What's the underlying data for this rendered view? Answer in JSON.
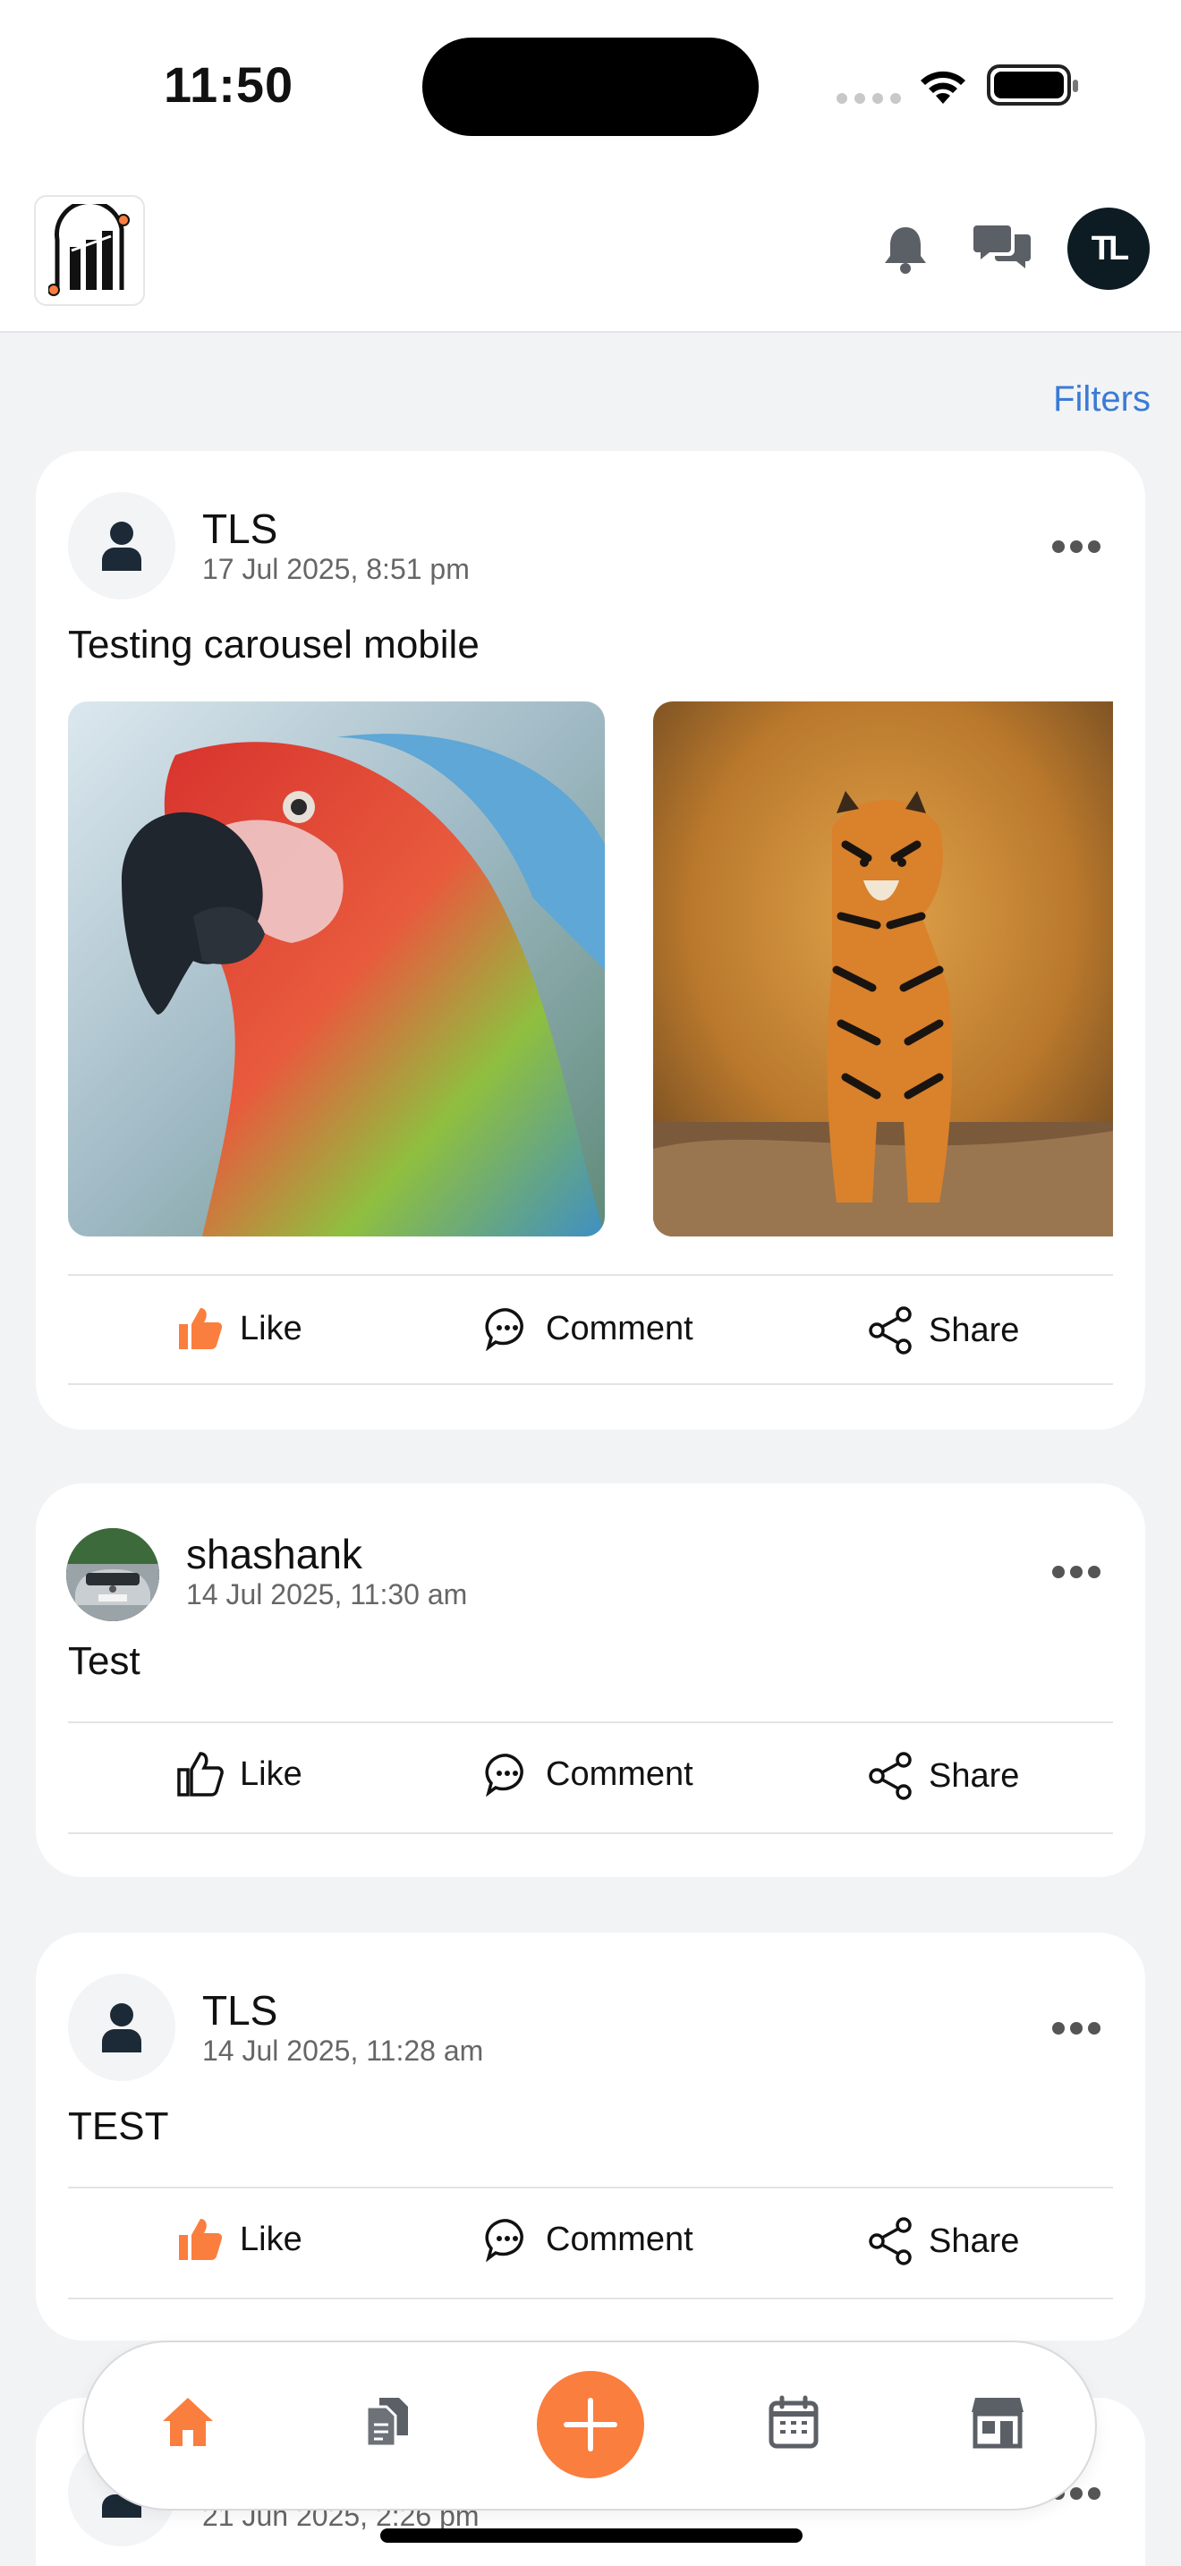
{
  "status_bar": {
    "time": "11:50"
  },
  "header": {
    "logo_icon": "building-logo-icon",
    "notification_icon": "bell-icon",
    "messages_icon": "chat-bubbles-icon",
    "user_initials": "TL"
  },
  "filters_label": "Filters",
  "posts": [
    {
      "author": "TLS",
      "date": "17 Jul 2025, 8:51 pm",
      "text": "Testing carousel mobile",
      "images": [
        "parrot-photo",
        "tiger-photo"
      ],
      "liked": true,
      "actions": {
        "like": "Like",
        "comment": "Comment",
        "share": "Share"
      }
    },
    {
      "author": "shashank",
      "date": "14 Jul 2025, 11:30 am",
      "text": "Test",
      "liked": false,
      "actions": {
        "like": "Like",
        "comment": "Comment",
        "share": "Share"
      }
    },
    {
      "author": "TLS",
      "date": "14 Jul 2025, 11:28 am",
      "text": "TEST",
      "liked": true,
      "actions": {
        "like": "Like",
        "comment": "Comment",
        "share": "Share"
      }
    },
    {
      "author": "",
      "date": "21 Jun 2025, 2:26 pm"
    }
  ],
  "bottom_nav": {
    "items": [
      "home-icon",
      "documents-icon",
      "add-icon",
      "calendar-icon",
      "store-icon"
    ],
    "active": "home-icon"
  },
  "colors": {
    "accent": "#fa7e3e",
    "link": "#3a7bd5",
    "background": "#f2f3f5"
  }
}
